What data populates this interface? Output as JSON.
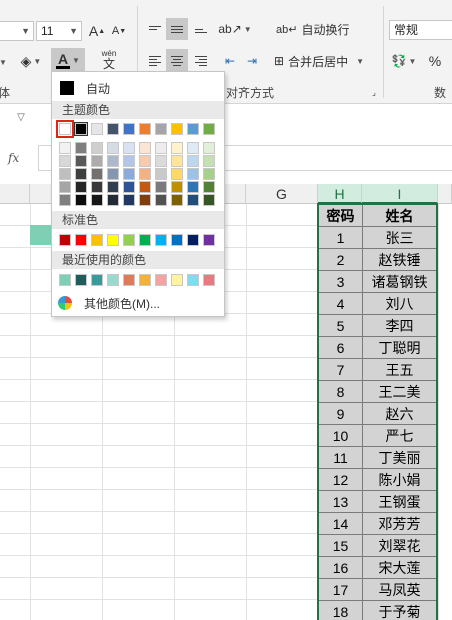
{
  "ribbon": {
    "font_size": "11",
    "grow_font": "A",
    "shrink_font": "A",
    "font_color_letter": "A",
    "phonetic_top": "wén",
    "phonetic_bottom": "文",
    "wrap_text": "自动换行",
    "merge_center": "合并后居中",
    "number_format": "常规",
    "percent": "%",
    "group_font_partial": "体",
    "group_alignment": "对齐方式",
    "group_number_partial": "数字"
  },
  "formula_bar": {
    "fx_label": "fx"
  },
  "dropdown": {
    "automatic": "自动",
    "theme_colors": "主题颜色",
    "standard_colors": "标准色",
    "recent_colors": "最近使用的颜色",
    "more_colors": "其他颜色(M)...",
    "theme_top": [
      "#ffffff",
      "#000000",
      "#e7e6e6",
      "#44546a",
      "#4472c4",
      "#ed7d31",
      "#a5a5a5",
      "#ffc000",
      "#5b9bd5",
      "#70ad47"
    ],
    "theme_shades": [
      [
        "#f2f2f2",
        "#7f7f7f",
        "#d0cece",
        "#d6dce4",
        "#d9e2f3",
        "#fbe5d5",
        "#ededed",
        "#fff2cc",
        "#deebf6",
        "#e2efd9"
      ],
      [
        "#d8d8d8",
        "#595959",
        "#aeabab",
        "#adb9ca",
        "#b4c6e7",
        "#f7cbac",
        "#dbdbdb",
        "#fee599",
        "#bdd7ee",
        "#c5e0b3"
      ],
      [
        "#bfbfbf",
        "#3f3f3f",
        "#757070",
        "#8496b0",
        "#8eaadb",
        "#f4b183",
        "#c9c9c9",
        "#ffd965",
        "#9cc3e5",
        "#a8d08d"
      ],
      [
        "#a5a5a5",
        "#262626",
        "#3a3838",
        "#323f4f",
        "#2f5496",
        "#c45911",
        "#7b7b7b",
        "#bf9000",
        "#2e75b5",
        "#538135"
      ],
      [
        "#7f7f7f",
        "#0c0c0c",
        "#171616",
        "#222a35",
        "#1f3864",
        "#833c0b",
        "#525252",
        "#7f6000",
        "#1e4e79",
        "#375623"
      ]
    ],
    "standard": [
      "#c00000",
      "#ff0000",
      "#ffc000",
      "#ffff00",
      "#92d050",
      "#00b050",
      "#00b0f0",
      "#0070c0",
      "#002060",
      "#7030a0"
    ],
    "recent": [
      "#7fcfb4",
      "#1f5c5c",
      "#3a9a9a",
      "#9ad9cf",
      "#e07b5a",
      "#f3b13b",
      "#f4a3a3",
      "#fff2a0",
      "#7fdcef",
      "#e77a80"
    ]
  },
  "grid": {
    "col_g": "G",
    "col_h": "H",
    "col_i": "I",
    "header": [
      "密码",
      "姓名"
    ],
    "rows": [
      [
        "1",
        "张三"
      ],
      [
        "2",
        "赵铁锤"
      ],
      [
        "3",
        "诸葛钢铁"
      ],
      [
        "4",
        "刘八"
      ],
      [
        "5",
        "李四"
      ],
      [
        "6",
        "丁聪明"
      ],
      [
        "7",
        "王五"
      ],
      [
        "8",
        "王二美"
      ],
      [
        "9",
        "赵六"
      ],
      [
        "10",
        "严七"
      ],
      [
        "11",
        "丁美丽"
      ],
      [
        "12",
        "陈小娟"
      ],
      [
        "13",
        "王钢蛋"
      ],
      [
        "14",
        "邓芳芳"
      ],
      [
        "15",
        "刘翠花"
      ],
      [
        "16",
        "宋大莲"
      ],
      [
        "17",
        "马凤英"
      ],
      [
        "18",
        "于予菊"
      ]
    ]
  },
  "colors": {
    "accent": "#217346",
    "selected_fill": "#7fcfb4"
  }
}
